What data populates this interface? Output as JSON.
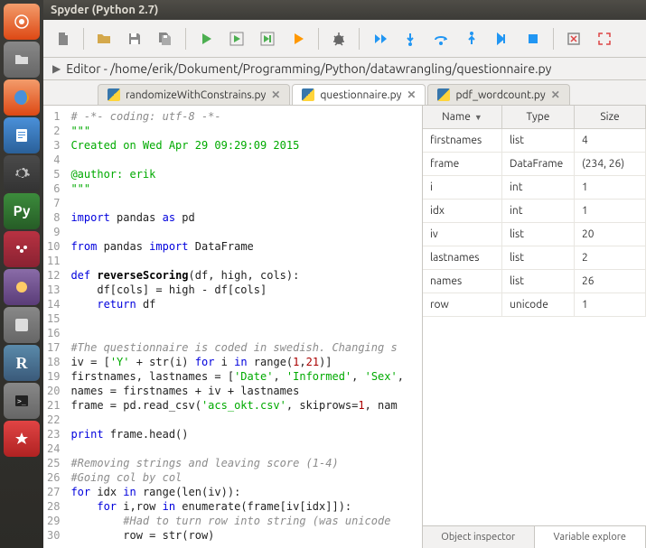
{
  "title": "Spyder (Python 2.7)",
  "path": "Editor - /home/erik/Dokument/Programming/Python/datawrangling/questionnaire.py",
  "tabs": [
    {
      "label": "randomizeWithConstrains.py",
      "active": false
    },
    {
      "label": "questionnaire.py",
      "active": true
    },
    {
      "label": "pdf_wordcount.py",
      "active": false
    }
  ],
  "code_lines": [
    {
      "n": 1,
      "raw": "# -*- coding: utf-8 -*-",
      "cls": "c-com"
    },
    {
      "n": 2,
      "raw": "\"\"\"",
      "cls": "c-str"
    },
    {
      "n": 3,
      "raw": "Created on Wed Apr 29 09:29:09 2015",
      "cls": "c-str"
    },
    {
      "n": 4,
      "raw": "",
      "cls": ""
    },
    {
      "n": 5,
      "raw": "@author: erik",
      "cls": "c-str"
    },
    {
      "n": 6,
      "raw": "\"\"\"",
      "cls": "c-str"
    },
    {
      "n": 7,
      "raw": "",
      "cls": ""
    }
  ],
  "var_headers": {
    "name": "Name",
    "type": "Type",
    "size": "Size"
  },
  "vars": [
    {
      "name": "firstnames",
      "type": "list",
      "size": "4"
    },
    {
      "name": "frame",
      "type": "DataFrame",
      "size": "(234, 26)"
    },
    {
      "name": "i",
      "type": "int",
      "size": "1"
    },
    {
      "name": "idx",
      "type": "int",
      "size": "1"
    },
    {
      "name": "iv",
      "type": "list",
      "size": "20"
    },
    {
      "name": "lastnames",
      "type": "list",
      "size": "2"
    },
    {
      "name": "names",
      "type": "list",
      "size": "26"
    },
    {
      "name": "row",
      "type": "unicode",
      "size": "1"
    }
  ],
  "right_tabs": {
    "inspector": "Object inspector",
    "varexp": "Variable explore"
  },
  "icons": {
    "new": "new-file",
    "open": "open-file",
    "save": "save",
    "saveall": "save-all",
    "run": "run",
    "runcell": "run-cell",
    "runconfig": "run-config",
    "debug": "debug",
    "stepin": "step-in",
    "stepover": "step-over",
    "stepout": "step-out",
    "stop": "stop",
    "maximize": "maximize",
    "fullscreen": "fullscreen"
  }
}
